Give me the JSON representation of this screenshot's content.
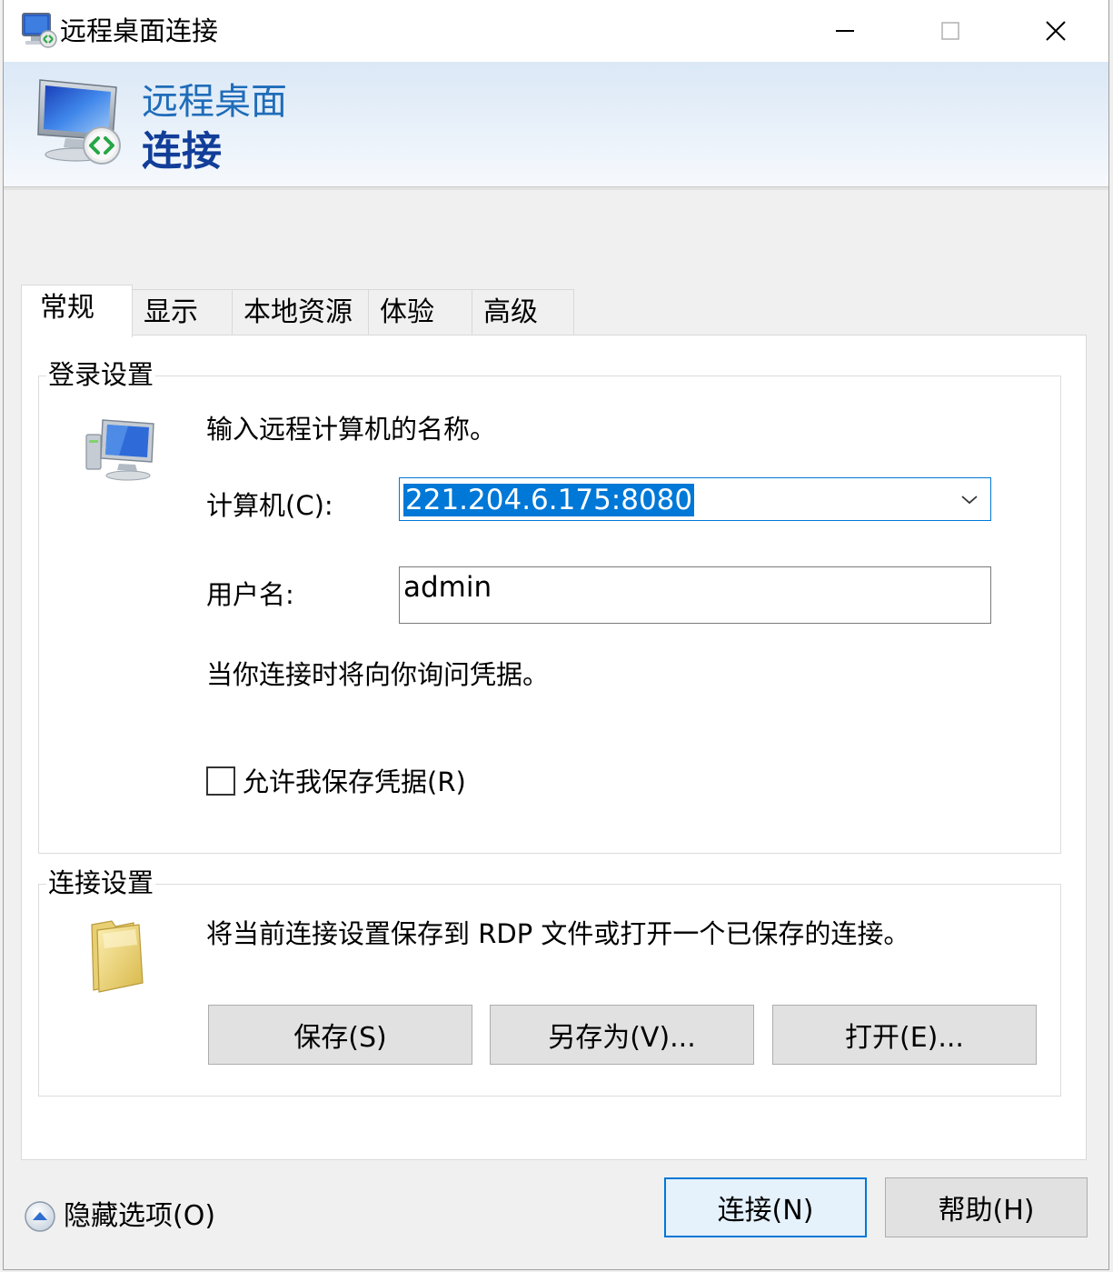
{
  "window": {
    "title": "远程桌面连接"
  },
  "banner": {
    "line1": "远程桌面",
    "line2": "连接"
  },
  "tabs": [
    {
      "label": "常规",
      "active": true
    },
    {
      "label": "显示",
      "active": false
    },
    {
      "label": "本地资源",
      "active": false
    },
    {
      "label": "体验",
      "active": false
    },
    {
      "label": "高级",
      "active": false
    }
  ],
  "login": {
    "legend": "登录设置",
    "prompt": "输入远程计算机的名称。",
    "computer_label": "计算机(C):",
    "computer_value": "221.204.6.175:8080",
    "username_label": "用户名:",
    "username_value": "admin",
    "credential_note": "当你连接时将向你询问凭据。",
    "save_credentials_label": "允许我保存凭据(R)",
    "save_credentials_checked": false
  },
  "connection": {
    "legend": "连接设置",
    "description": "将当前连接设置保存到 RDP 文件或打开一个已保存的连接。",
    "save_label": "保存(S)",
    "save_as_label": "另存为(V)...",
    "open_label": "打开(E)..."
  },
  "footer": {
    "hide_options_label": "隐藏选项(O)",
    "connect_label": "连接(N)",
    "help_label": "帮助(H)"
  },
  "icons": {
    "app": "remote-desktop-icon",
    "banner": "remote-desktop-monitor-icon",
    "computer": "computer-icon",
    "folder": "folder-icon",
    "hide": "chevron-up-circle-icon"
  },
  "colors": {
    "accent": "#0078d7",
    "banner_title1": "#1f6cb9",
    "banner_title2": "#123e99"
  }
}
